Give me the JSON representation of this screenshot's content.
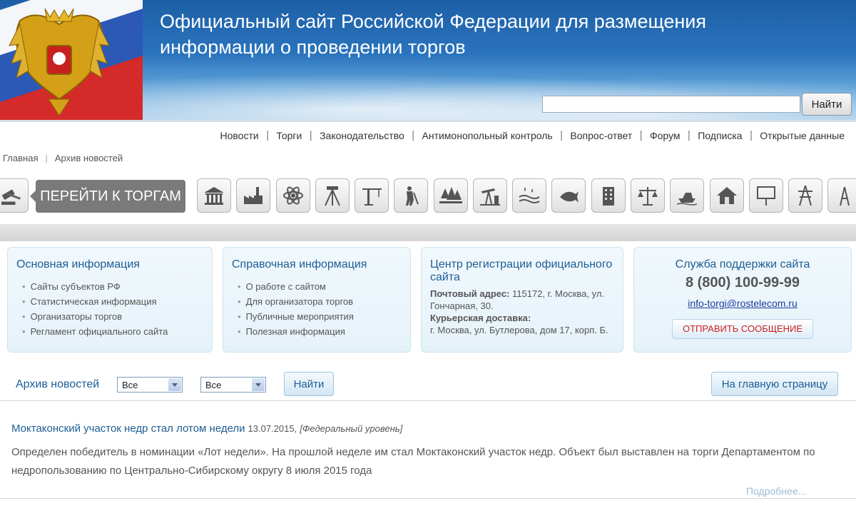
{
  "header": {
    "title_line1": "Официальный сайт Российской Федерации для размещения",
    "title_line2": "информации о проведении торгов",
    "search_value": "",
    "search_button": "Найти"
  },
  "topnav": [
    "Новости",
    "Торги",
    "Законодательство",
    "Антимонопольный контроль",
    "Вопрос-ответ",
    "Форум",
    "Подписка",
    "Открытые данные"
  ],
  "breadcrumb": [
    "Главная",
    "Архив новостей"
  ],
  "goto_auctions": "ПЕРЕЙТИ К ТОРГАМ",
  "categories": [
    "building-icon",
    "factory-icon",
    "atom-icon",
    "surveying-icon",
    "crane-icon",
    "geologist-icon",
    "forest-icon",
    "oil-pump-icon",
    "water-icon",
    "fish-icon",
    "skyscraper-icon",
    "scales-icon",
    "boat-icon",
    "house-icon",
    "billboard-icon",
    "power-line-icon",
    "antenna-icon"
  ],
  "boxes": {
    "main": {
      "title": "Основная информация",
      "items": [
        "Сайты субъектов РФ",
        "Статистическая информация",
        "Организаторы торгов",
        "Регламент официального сайта"
      ]
    },
    "reference": {
      "title": "Справочная информация",
      "items": [
        "О работе с сайтом",
        "Для организатора торгов",
        "Публичные мероприятия",
        "Полезная информация"
      ]
    },
    "registration": {
      "title": "Центр регистрации официального сайта",
      "postal_label": "Почтовый адрес:",
      "postal_value": "115172, г. Москва, ул. Гончарная, 30.",
      "courier_label": "Курьерская доставка:",
      "courier_value": "г. Москва, ул. Бутлерова, дом 17, корп. Б."
    },
    "support": {
      "title": "Служба поддержки сайта",
      "phone": "8 (800) 100-99-99",
      "email": "info-torgi@rostelecom.ru",
      "send_button": "ОТПРАВИТЬ СООБЩЕНИЕ"
    }
  },
  "filter": {
    "label": "Архив новостей",
    "select1": "Все",
    "select2": "Все",
    "find_button": "Найти",
    "home_button": "На главную страницу"
  },
  "news": {
    "title": "Моктаконский участок недр стал лотом недели",
    "date": "13.07.2015,",
    "level": "[Федеральный уровень]",
    "text": "Определен победитель в номинации «Лот недели». На прошлой неделе им стал Моктаконский участок недр. Объект был выставлен на торги Департаментом по недропользованию по Центрально-Сибирскому округу 8 июля 2015 года",
    "more": "Подробнее..."
  },
  "colors": {
    "header_blue": "#2a74bd",
    "link_blue": "#1e5d94",
    "accent_red": "#cc2222"
  }
}
